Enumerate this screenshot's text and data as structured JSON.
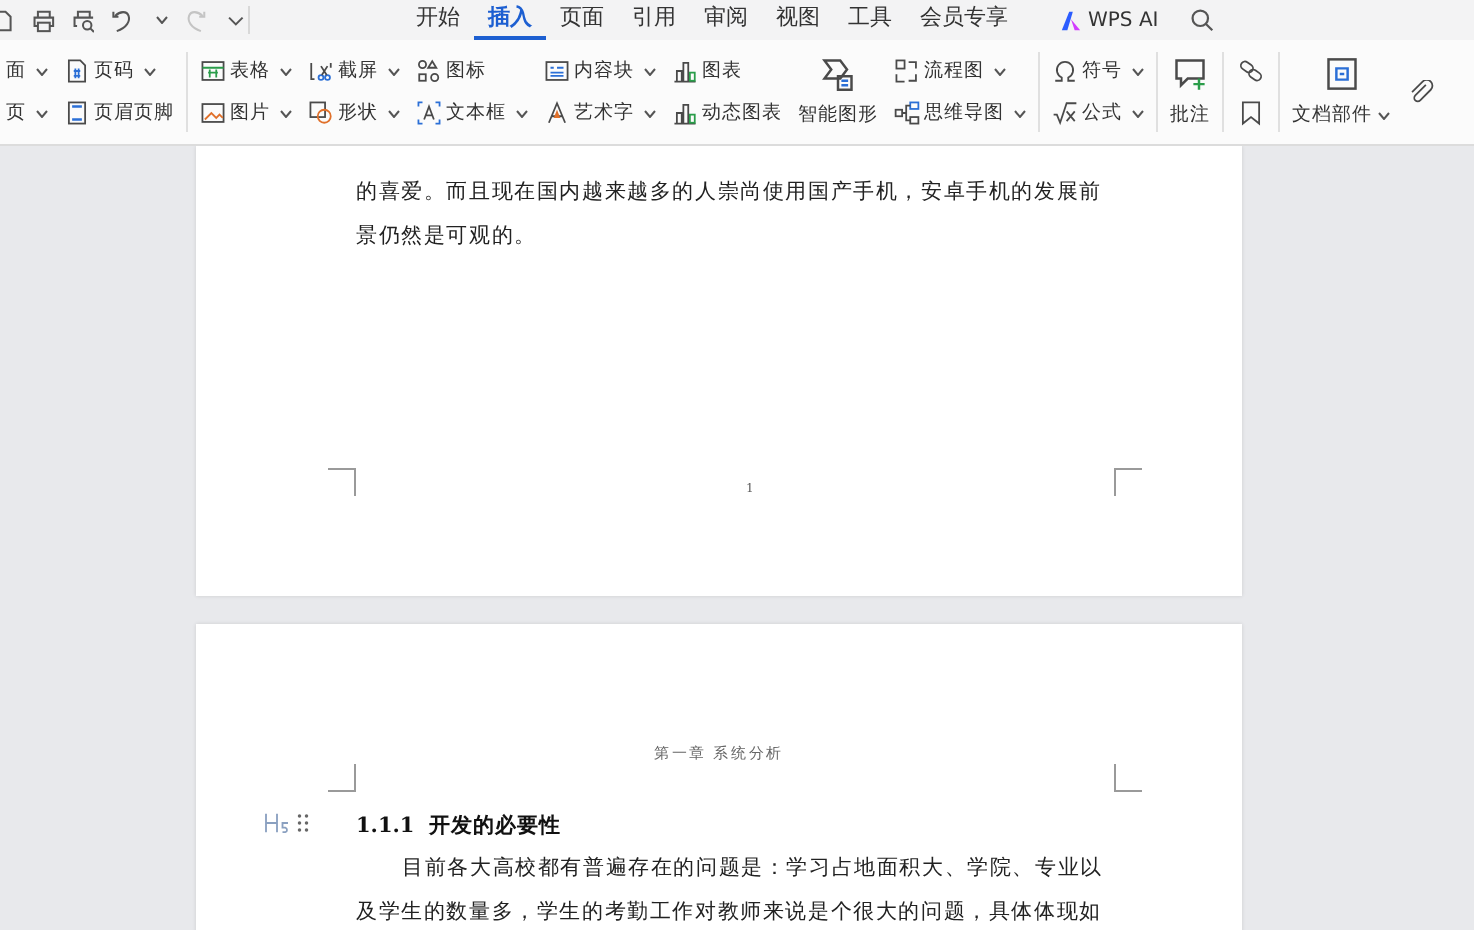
{
  "tabs": [
    {
      "label": "开始",
      "selected": false
    },
    {
      "label": "插入",
      "selected": true
    },
    {
      "label": "页面",
      "selected": false
    },
    {
      "label": "引用",
      "selected": false
    },
    {
      "label": "审阅",
      "selected": false
    },
    {
      "label": "视图",
      "selected": false
    },
    {
      "label": "工具",
      "selected": false
    },
    {
      "label": "会员专享",
      "selected": false
    }
  ],
  "ai_button": {
    "label": "WPS AI"
  },
  "ribbon_groups": [
    {
      "columns": [
        {
          "kind": "stack",
          "items": [
            {
              "label": "面",
              "dropdown": true
            },
            {
              "label": "页",
              "dropdown": true
            }
          ]
        },
        {
          "kind": "stack",
          "items": [
            {
              "label": "页码",
              "dropdown": true
            },
            {
              "label": "页眉页脚",
              "dropdown": false
            }
          ]
        }
      ]
    },
    {
      "columns": [
        {
          "kind": "stack",
          "items": [
            {
              "label": "表格",
              "dropdown": true
            },
            {
              "label": "图片",
              "dropdown": true
            }
          ]
        },
        {
          "kind": "stack",
          "items": [
            {
              "label": "截屏",
              "dropdown": true
            },
            {
              "label": "形状",
              "dropdown": true
            }
          ]
        },
        {
          "kind": "stack",
          "items": [
            {
              "label": "图标",
              "dropdown": false
            },
            {
              "label": "文本框",
              "dropdown": true
            }
          ]
        },
        {
          "kind": "stack",
          "items": [
            {
              "label": "内容块",
              "dropdown": true
            },
            {
              "label": "艺术字",
              "dropdown": true
            }
          ]
        },
        {
          "kind": "stack",
          "items": [
            {
              "label": "图表",
              "dropdown": false
            },
            {
              "label": "动态图表",
              "dropdown": false
            }
          ]
        },
        {
          "kind": "large",
          "items": [
            {
              "label": "智能图形",
              "dropdown": false
            }
          ]
        },
        {
          "kind": "stack",
          "items": [
            {
              "label": "流程图",
              "dropdown": true
            },
            {
              "label": "思维导图",
              "dropdown": true
            }
          ]
        }
      ]
    },
    {
      "columns": [
        {
          "kind": "stack",
          "items": [
            {
              "label": "符号",
              "dropdown": true
            },
            {
              "label": "公式",
              "dropdown": true
            }
          ]
        }
      ]
    },
    {
      "columns": [
        {
          "kind": "large",
          "items": [
            {
              "label": "批注",
              "dropdown": false
            }
          ]
        }
      ]
    },
    {
      "columns": [
        {
          "kind": "stack",
          "items": [
            {
              "dropdown": false
            },
            {
              "dropdown": false
            }
          ]
        }
      ]
    },
    {
      "columns": [
        {
          "kind": "large",
          "items": [
            {
              "label": "文档部件",
              "dropdown": true
            }
          ]
        },
        {
          "kind": "stack",
          "items": [
            {
              "dropdown": false
            }
          ]
        }
      ]
    }
  ],
  "pages": [
    {
      "paragraphs": [
        {
          "text": "的喜爱。而且现在国内越来越多的人崇尚使用国产手机，安卓手机的发展前景仍然是可观的。",
          "indent": false
        }
      ],
      "page_number": "1"
    },
    {
      "header": "第一章  系统分析",
      "heading": {
        "number": "1.1.1",
        "title": "开发的必要性"
      },
      "paragraphs": [
        {
          "text": "目前各大高校都有普遍存在的问题是：学习占地面积大、学院、专业以及学生的数量多，学生的考勤工作对教师来说是个很大的问题，具体体现如",
          "indent": true
        }
      ]
    }
  ]
}
